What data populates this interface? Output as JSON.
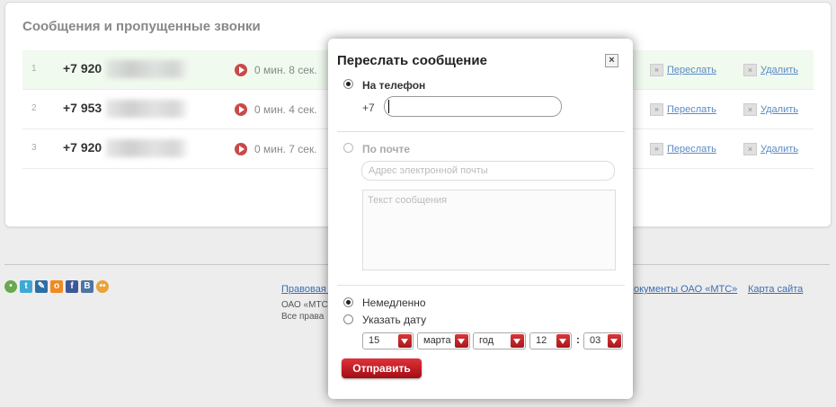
{
  "page": {
    "title": "Сообщения и пропущенные звонки",
    "rows": [
      {
        "num": "1",
        "phone": "+7 920",
        "duration": "0 мин. 8 сек.",
        "forward": "Переслать",
        "delete": "Удалить"
      },
      {
        "num": "2",
        "phone": "+7 953",
        "duration": "0 мин. 4 сек.",
        "forward": "Переслать",
        "delete": "Удалить"
      },
      {
        "num": "3",
        "phone": "+7 920",
        "duration": "0 мин. 7 сек.",
        "forward": "Переслать",
        "delete": "Удалить"
      }
    ]
  },
  "footer": {
    "legal_link": "Правовая и",
    "org_line": "ОАО «МТС",
    "rights_line": "Все права",
    "docs_link": "окументы ОАО «МТС»",
    "sitemap_link": "Карта сайта",
    "social_icons": [
      "people-icon",
      "twitter-icon",
      "livejournal-icon",
      "odnoklassniki-icon",
      "facebook-icon",
      "vkontakte-icon",
      "moikrug-icon"
    ]
  },
  "modal": {
    "title": "Переслать сообщение",
    "close_icon": "×",
    "to_phone_label": "На телефон",
    "phone_prefix": "+7",
    "phone_value": "",
    "to_email_label": "По почте",
    "email_placeholder": "Адрес электронной почты",
    "message_placeholder": "Текст сообщения",
    "immediately_label": "Немедленно",
    "set_date_label": "Указать дату",
    "date": {
      "day": "15",
      "month": "марта",
      "year": "год",
      "hour": "12",
      "minute": "03"
    },
    "time_separator": ":",
    "send_button": "Отправить"
  },
  "colors": {
    "accent": "#c0141c",
    "link": "#5b8ac5",
    "highlight_row": "#f0faee"
  }
}
